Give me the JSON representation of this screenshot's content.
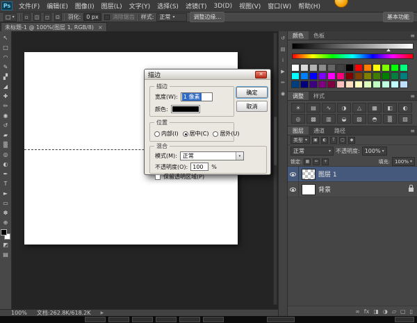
{
  "window": {
    "logo": "Ps",
    "menus": [
      "文件(F)",
      "编辑(E)",
      "图像(I)",
      "图层(L)",
      "文字(Y)",
      "选择(S)",
      "滤镜(T)",
      "3D(D)",
      "视图(V)",
      "窗口(W)",
      "帮助(H)"
    ]
  },
  "options_bar": {
    "tool_icon": "□",
    "mode_icons": [
      {
        "name": "new-selection-icon",
        "glyph": "▫"
      },
      {
        "name": "add-selection-icon",
        "glyph": "◫"
      },
      {
        "name": "subtract-selection-icon",
        "glyph": "◻"
      },
      {
        "name": "intersect-selection-icon",
        "glyph": "⊡"
      }
    ],
    "feather_label": "羽化:",
    "feather_value": "0 px",
    "antialias_label": "消除锯齿",
    "style_label": "样式:",
    "style_value": "正常",
    "refine_edge_label": "调整边缘…",
    "workspace_label": "基本功能"
  },
  "document_tab": {
    "title": "未标题-1 @ 100%(图层 1, RGB/8)",
    "close_glyph": "×"
  },
  "toolbar": {
    "tools": [
      {
        "name": "move-tool",
        "glyph": "↖"
      },
      {
        "name": "rectangular-marquee-tool",
        "glyph": "□"
      },
      {
        "name": "lasso-tool",
        "glyph": "◠"
      },
      {
        "name": "quick-selection-tool",
        "glyph": "✎"
      },
      {
        "name": "crop-tool",
        "glyph": "▞"
      },
      {
        "name": "eyedropper-tool",
        "glyph": "◢"
      },
      {
        "name": "spot-healing-brush-tool",
        "glyph": "✚"
      },
      {
        "name": "brush-tool",
        "glyph": "✏"
      },
      {
        "name": "clone-stamp-tool",
        "glyph": "◉"
      },
      {
        "name": "history-brush-tool",
        "glyph": "↺"
      },
      {
        "name": "eraser-tool",
        "glyph": "▰"
      },
      {
        "name": "gradient-tool",
        "glyph": "▒"
      },
      {
        "name": "blur-tool",
        "glyph": "◎"
      },
      {
        "name": "dodge-tool",
        "glyph": "◐"
      },
      {
        "name": "pen-tool",
        "glyph": "✒"
      },
      {
        "name": "type-tool",
        "glyph": "T"
      },
      {
        "name": "path-selection-tool",
        "glyph": "►"
      },
      {
        "name": "rectangle-tool",
        "glyph": "▭"
      },
      {
        "name": "hand-tool",
        "glyph": "✽"
      },
      {
        "name": "zoom-tool",
        "glyph": "⊕"
      }
    ],
    "extras": [
      {
        "name": "quick-mask-icon",
        "glyph": "◩"
      },
      {
        "name": "screen-mode-icon",
        "glyph": "▤"
      }
    ]
  },
  "dialog": {
    "title": "描边",
    "close_glyph": "✕",
    "stroke": {
      "group_label": "描边",
      "width_label": "宽度(W):",
      "width_value": "1 像素",
      "color_label": "颜色:"
    },
    "buttons": {
      "ok": "确定",
      "cancel": "取消"
    },
    "position": {
      "group_label": "位置",
      "inside": "内部(I)",
      "center": "居中(C)",
      "outside": "居外(U)",
      "selected": "居中(C)"
    },
    "blend": {
      "group_label": "混合",
      "mode_label": "模式(M):",
      "mode_value": "正常",
      "opacity_label": "不透明度(O):",
      "opacity_value": "100",
      "percent_sign": "%",
      "preserve_label": "保留透明区域(P)"
    }
  },
  "rightdock": {
    "dock_icons": [
      {
        "name": "history-panel-icon",
        "glyph": "↺"
      },
      {
        "name": "properties-panel-icon",
        "glyph": "▤"
      },
      {
        "name": "info-panel-icon",
        "glyph": "i"
      },
      {
        "name": "actions-panel-icon",
        "glyph": "▶"
      },
      {
        "name": "brush-panel-icon",
        "glyph": "✏"
      },
      {
        "name": "clone-source-panel-icon",
        "glyph": "◉"
      }
    ]
  },
  "panels": {
    "color": {
      "tabs": [
        "颜色",
        "色板"
      ]
    },
    "swatches": {
      "colors": [
        "#ffffff",
        "#d9d9d9",
        "#b3b3b3",
        "#8c8c8c",
        "#666666",
        "#404040",
        "#000000",
        "#ff0000",
        "#ff7f00",
        "#ffff00",
        "#7fff00",
        "#00ff00",
        "#00ff7f",
        "#00ffff",
        "#007fff",
        "#0000ff",
        "#7f00ff",
        "#ff00ff",
        "#ff007f",
        "#7f0000",
        "#7f3f00",
        "#7f7f00",
        "#3f7f00",
        "#007f00",
        "#007f3f",
        "#007f7f",
        "#003f7f",
        "#00007f",
        "#3f007f",
        "#7f007f",
        "#7f003f",
        "#ffbfbf",
        "#ffdfbf",
        "#ffffbf",
        "#dfffbf",
        "#bfffbf",
        "#bfffdf",
        "#bfffff",
        "#bfdfff"
      ]
    },
    "adjustments": {
      "tabs": [
        "调整",
        "样式"
      ],
      "icons": [
        {
          "name": "brightness-contrast-icon",
          "glyph": "☀"
        },
        {
          "name": "levels-icon",
          "glyph": "▤"
        },
        {
          "name": "curves-icon",
          "glyph": "∿"
        },
        {
          "name": "exposure-icon",
          "glyph": "◑"
        },
        {
          "name": "vibrance-icon",
          "glyph": "△"
        },
        {
          "name": "hue-saturation-icon",
          "glyph": "▦"
        },
        {
          "name": "color-balance-icon",
          "glyph": "◧"
        },
        {
          "name": "black-white-icon",
          "glyph": "◐"
        },
        {
          "name": "photo-filter-icon",
          "glyph": "◎"
        },
        {
          "name": "channel-mixer-icon",
          "glyph": "▩"
        },
        {
          "name": "color-lookup-icon",
          "glyph": "▥"
        },
        {
          "name": "invert-icon",
          "glyph": "◒"
        },
        {
          "name": "posterize-icon",
          "glyph": "▧"
        },
        {
          "name": "threshold-icon",
          "glyph": "◓"
        },
        {
          "name": "gradient-map-icon",
          "glyph": "▒"
        },
        {
          "name": "selective-color-icon",
          "glyph": "▨"
        }
      ]
    },
    "layers": {
      "tabs": [
        "图层",
        "通道",
        "路径"
      ],
      "filter_label": "类型",
      "filter_icons": [
        {
          "name": "pixel-filter-icon",
          "glyph": "▣"
        },
        {
          "name": "adjustment-filter-icon",
          "glyph": "◐"
        },
        {
          "name": "type-filter-icon",
          "glyph": "T"
        },
        {
          "name": "shape-filter-icon",
          "glyph": "▢"
        },
        {
          "name": "smart-filter-icon",
          "glyph": "◆"
        }
      ],
      "blend_mode": "正常",
      "opacity_label": "不透明度:",
      "opacity_value": "100%",
      "lock_label": "锁定:",
      "lock_icons": [
        {
          "name": "lock-transparent-icon",
          "glyph": "▦"
        },
        {
          "name": "lock-pixels-icon",
          "glyph": "✏"
        },
        {
          "name": "lock-position-icon",
          "glyph": "+"
        }
      ],
      "fill_label": "填充:",
      "fill_value": "100%",
      "layers": [
        {
          "name": "图层 1",
          "selected": true,
          "thumb": "checker"
        },
        {
          "name": "背景",
          "selected": false,
          "thumb": "white",
          "locked": true
        }
      ],
      "bottom_icons": [
        {
          "name": "link-layers-icon",
          "glyph": "∞"
        },
        {
          "name": "layer-style-icon",
          "glyph": "fx"
        },
        {
          "name": "add-mask-icon",
          "glyph": "◨"
        },
        {
          "name": "new-adjustment-layer-icon",
          "glyph": "◑"
        },
        {
          "name": "new-group-icon",
          "glyph": "▱"
        },
        {
          "name": "new-layer-icon",
          "glyph": "▢"
        },
        {
          "name": "delete-layer-icon",
          "glyph": "▯"
        }
      ]
    }
  },
  "status_bar": {
    "zoom": "100%",
    "doc_info": "文档:262.8K/618.2K",
    "arrow_glyph": "▶"
  },
  "glyphs": {
    "caret": "▾",
    "menu_icon": "≡"
  },
  "colors": {
    "layer_selection": "#45597c",
    "dialog_text_selection": "#316ac5",
    "stroke_color": "#000000"
  }
}
